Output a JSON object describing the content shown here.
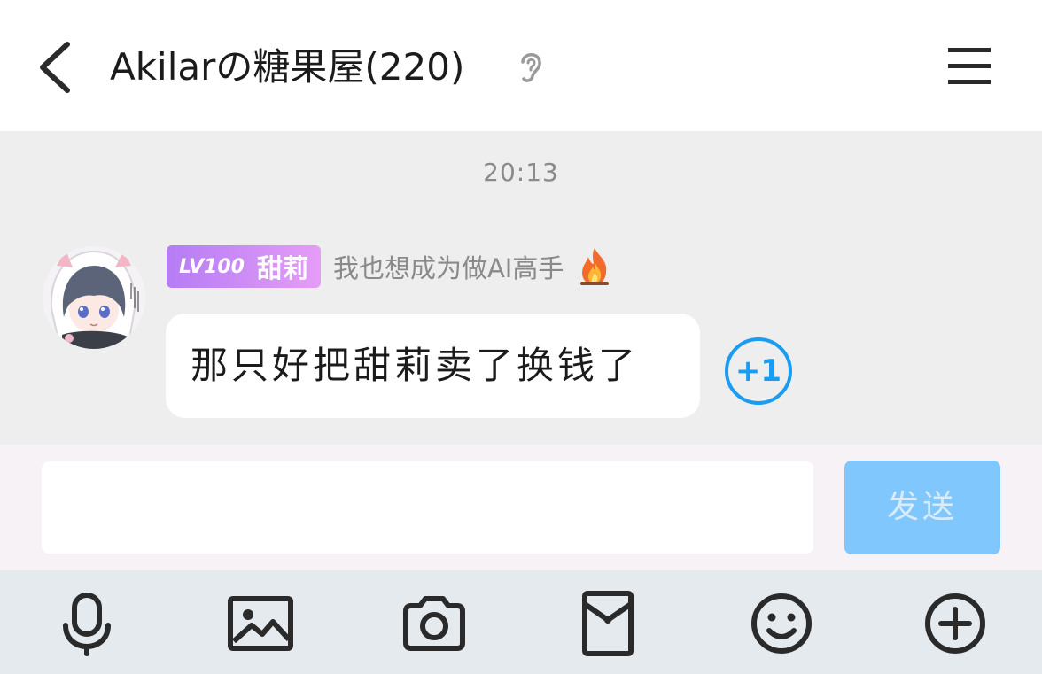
{
  "header": {
    "title": "Akilarの糖果屋(220)"
  },
  "chat": {
    "timestamp": "20:13",
    "message": {
      "level": "LV100",
      "nickname": "甜莉",
      "signature": "我也想成为做AI高手",
      "text": "那只好把甜莉卖了换钱了",
      "reaction": "+1"
    }
  },
  "input": {
    "value": "",
    "placeholder": "",
    "send_label": "发送"
  },
  "toolbar": {
    "items": [
      "microphone-icon",
      "image-icon",
      "camera-icon",
      "red-packet-icon",
      "emoji-icon",
      "plus-icon"
    ]
  },
  "colors": {
    "accent": "#1a9cf0",
    "send_button": "#80c7fd",
    "badge_gradient_start": "#b57cf4",
    "badge_gradient_end": "#e59df6",
    "chat_background": "#eeeeee",
    "toolbar_background": "#e5eaee"
  }
}
